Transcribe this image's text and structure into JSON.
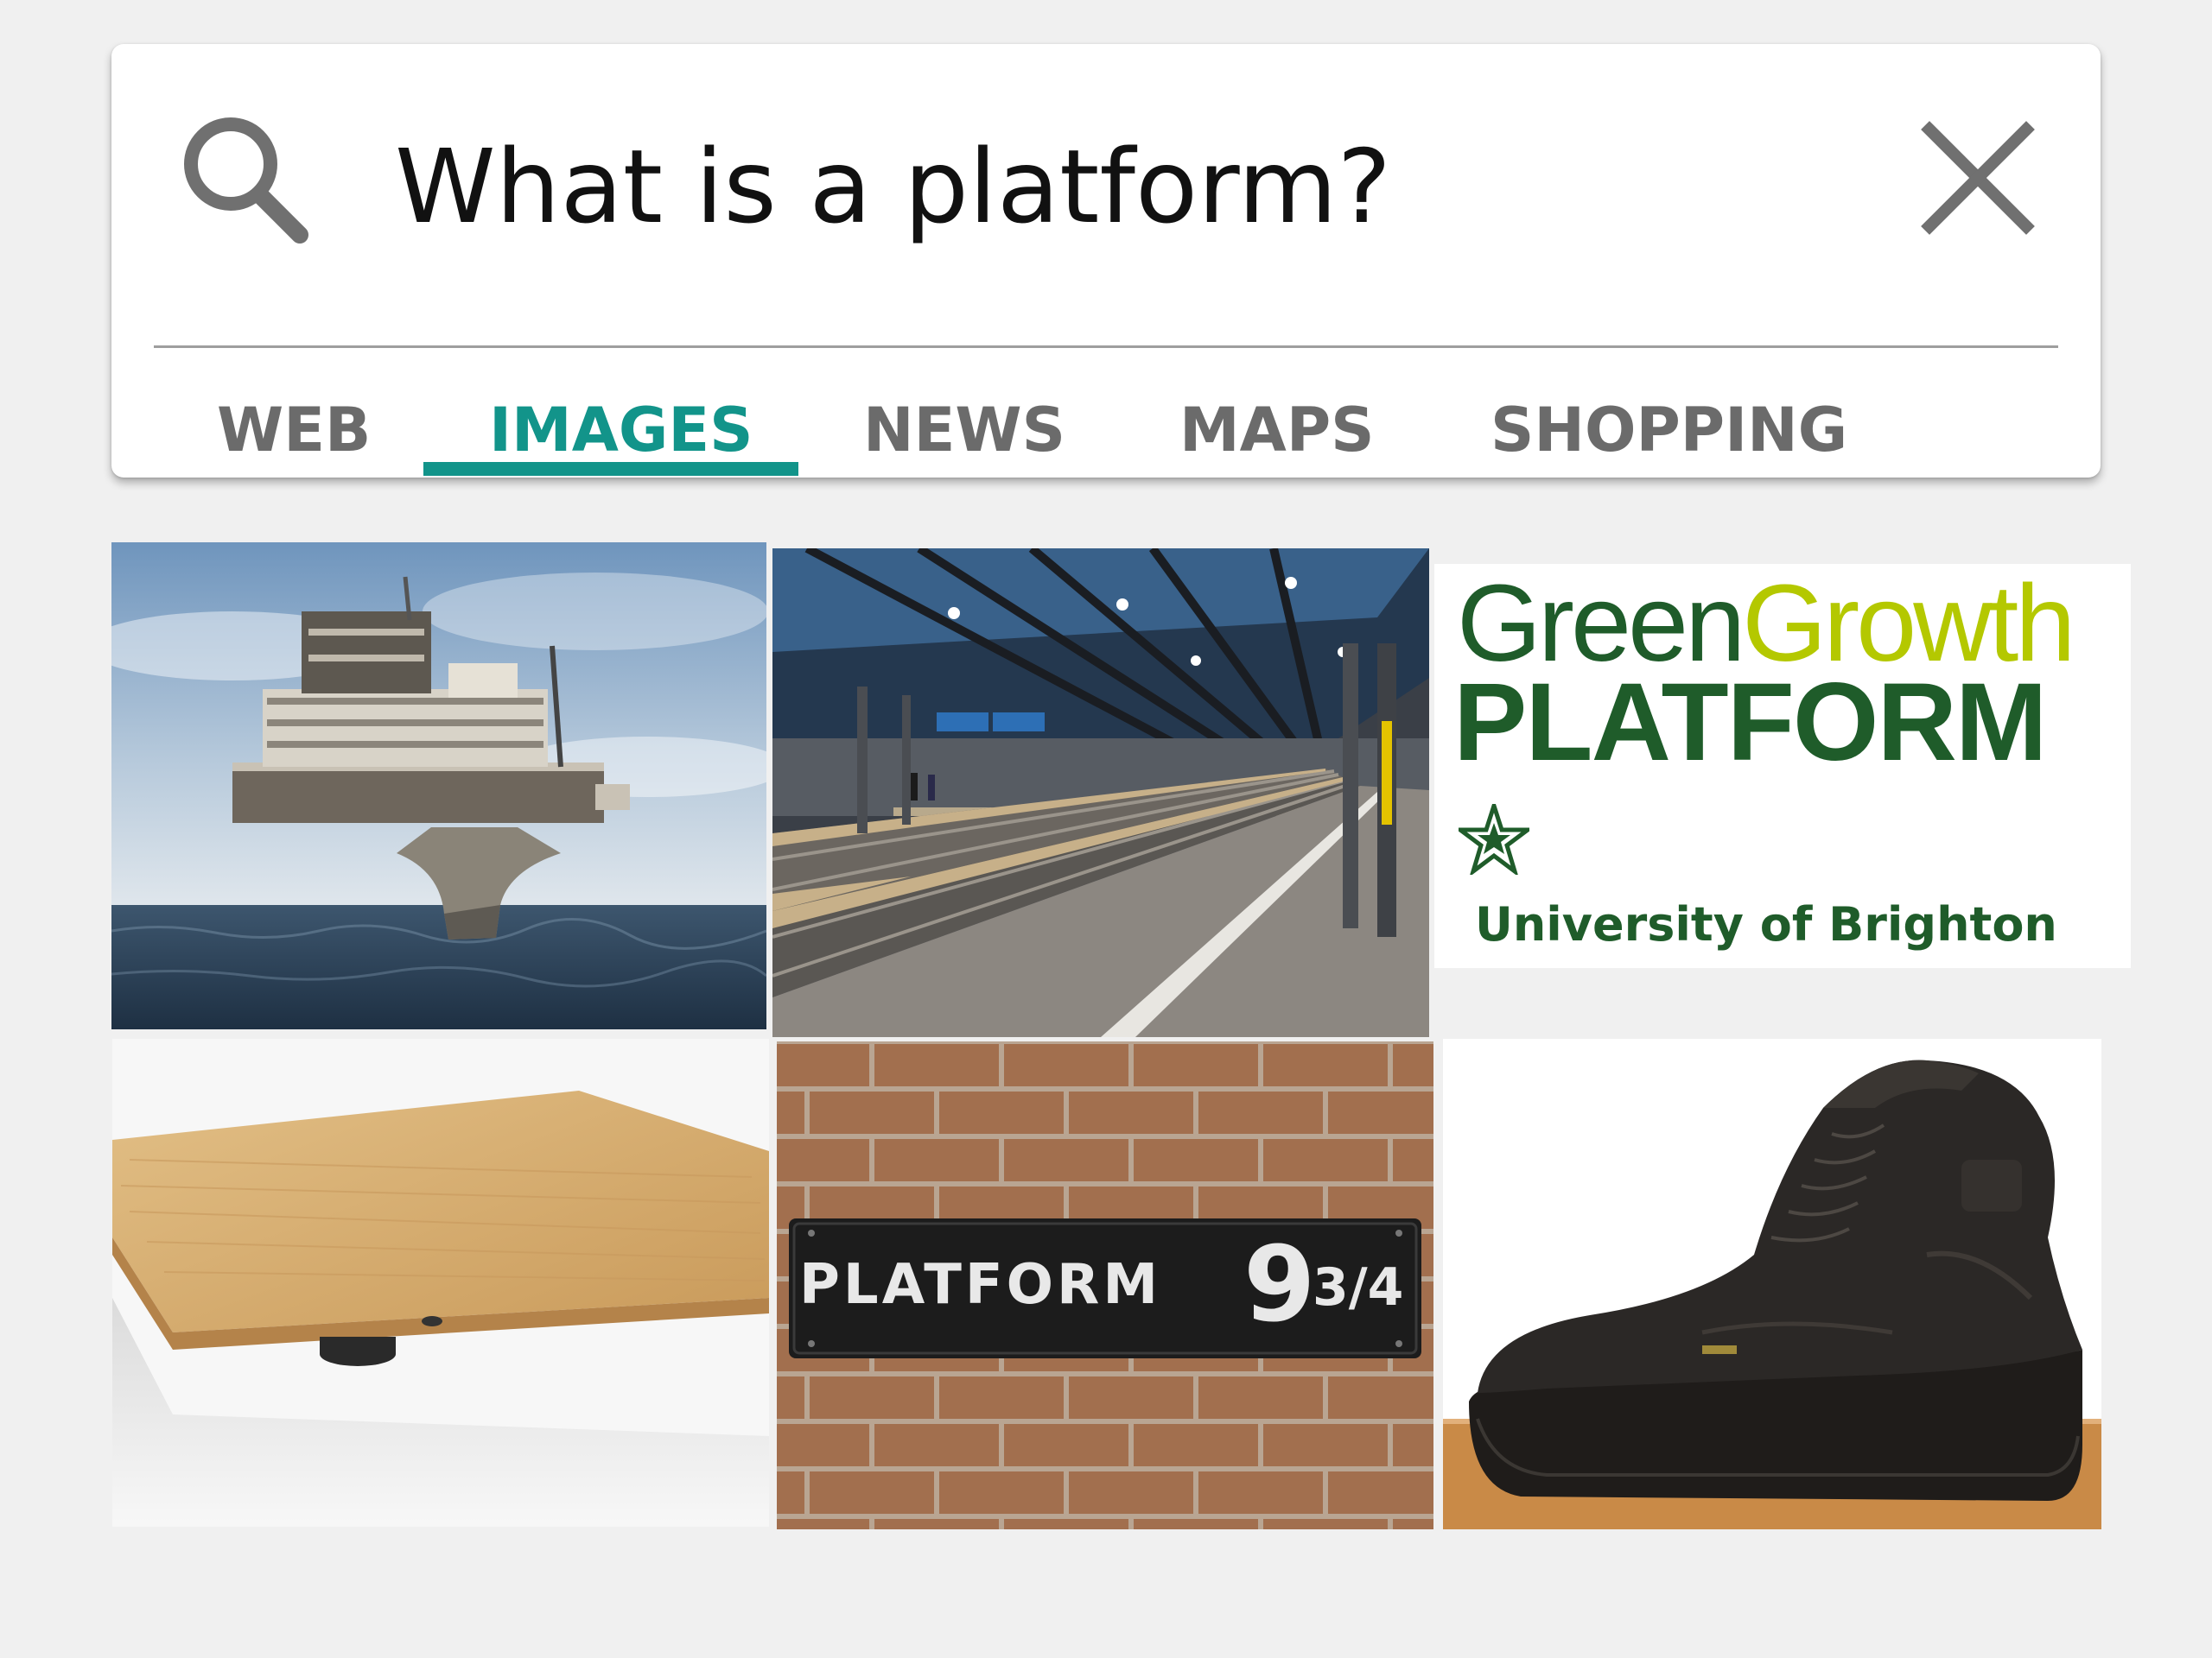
{
  "search": {
    "query": "What is a platform?",
    "search_icon": "search-icon",
    "clear_icon": "close-icon"
  },
  "tabs": [
    {
      "label": "WEB",
      "active": false
    },
    {
      "label": "IMAGES",
      "active": true
    },
    {
      "label": "NEWS",
      "active": false
    },
    {
      "label": "MAPS",
      "active": false
    },
    {
      "label": "SHOPPING",
      "active": false
    }
  ],
  "colors": {
    "accent": "#12948a",
    "tab_inactive": "#6b6b6b",
    "background": "#f0f0f0",
    "card": "#ffffff"
  },
  "results": [
    {
      "subject": "offshore oil platform"
    },
    {
      "subject": "train station platform"
    },
    {
      "subject": "Green Growth Platform logo",
      "logo_text": {
        "word1": "Green",
        "word2": "Growth",
        "word3": "PLATFORM",
        "org": "University of Brighton"
      }
    },
    {
      "subject": "wooden platform board"
    },
    {
      "subject": "Platform 9 3/4 sign",
      "sign_text": "PLATFORM",
      "sign_number": "9",
      "sign_fraction": "3/4"
    },
    {
      "subject": "platform shoe"
    }
  ]
}
